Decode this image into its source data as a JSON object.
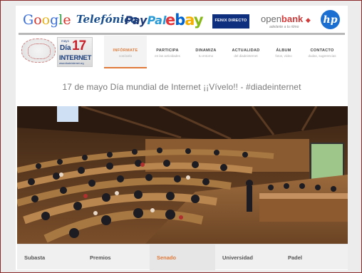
{
  "sponsors": {
    "google": [
      "G",
      "o",
      "o",
      "g",
      "l",
      "e"
    ],
    "google_colors": [
      "#3b6fd8",
      "#d8342c",
      "#e8b21a",
      "#3b6fd8",
      "#2f9e45",
      "#d8342c"
    ],
    "telefonica": "Telefónica",
    "paypal_a": "Pay",
    "paypal_b": "Pal",
    "ebay": [
      "e",
      "b",
      "a",
      "y"
    ],
    "ebay_colors": [
      "#e53238",
      "#0064d2",
      "#f5af02",
      "#86b817"
    ],
    "fenix": "FENIX DIRECTO",
    "openbank_a": "open",
    "openbank_b": "bank",
    "openbank_tag": "adelante a tu ritmo",
    "hp": "hp"
  },
  "site_logo": {
    "mayo": "mayo",
    "dia": "Día",
    "number": "17",
    "internet": "INTERNET",
    "url": "www.diadeinternet.org"
  },
  "nav": [
    {
      "title": "INFÓRMATE",
      "sub": "conócelo"
    },
    {
      "title": "PARTICIPA",
      "sub": "en las actividades"
    },
    {
      "title": "DINAMIZA",
      "sub": "tu entorno"
    },
    {
      "title": "ACTUALIDAD",
      "sub": "del diadeinternet"
    },
    {
      "title": "ÁLBUM",
      "sub": "fotos, vídeo"
    },
    {
      "title": "CONTACTO",
      "sub": "dudas, sugerencias"
    }
  ],
  "headline": "17 de mayo Día mundial de Internet  ¡¡Vívelo!! - #diadeinternet",
  "tabs": [
    "Subasta",
    "Premios",
    "Senado",
    "Universidad",
    "Padel"
  ],
  "active_tab": "Senado",
  "colors": {
    "accent": "#e07a3a",
    "frame": "#8a2a2a"
  }
}
